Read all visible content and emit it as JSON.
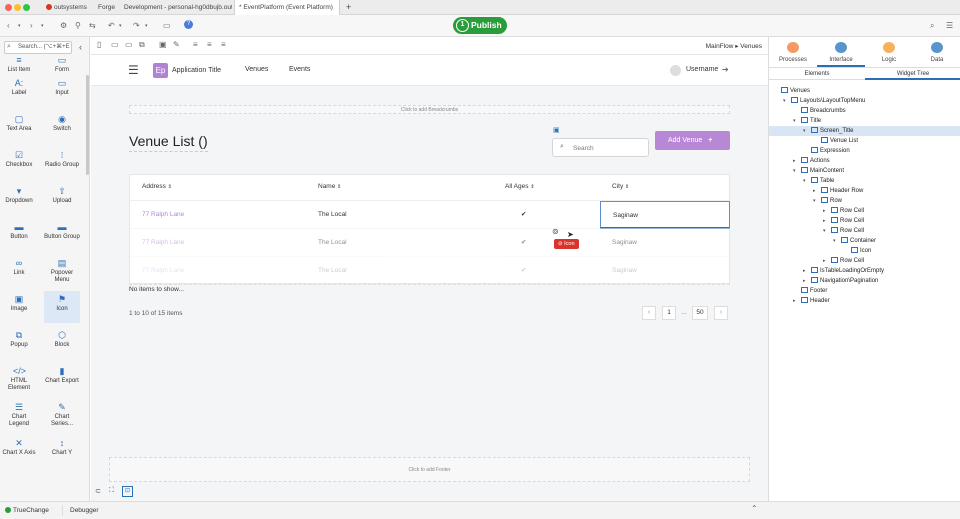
{
  "browser": {
    "tabs": [
      "outsystems",
      "Forge",
      "Development - personal-hg0dbujb.outs",
      "* EventPlatform (Event Platform)"
    ],
    "new_tab": "+"
  },
  "toolbar": {
    "publish_step": "1",
    "publish_label": "Publish",
    "help": "?"
  },
  "palette": {
    "search_placeholder": "Search... (⌥+⌘+E",
    "items": [
      {
        "label": "List Item",
        "icon": "list-item-icon",
        "glyph": "≡"
      },
      {
        "label": "Form",
        "icon": "form-icon",
        "glyph": "▭"
      },
      {
        "label": "Label",
        "icon": "label-icon",
        "glyph": "A:"
      },
      {
        "label": "Input",
        "icon": "input-icon",
        "glyph": "▭"
      },
      {
        "label": "Text Area",
        "icon": "text-area-icon",
        "glyph": "▢"
      },
      {
        "label": "Switch",
        "icon": "switch-icon",
        "glyph": "◉"
      },
      {
        "label": "Checkbox",
        "icon": "checkbox-icon",
        "glyph": "☑"
      },
      {
        "label": "Radio Group",
        "icon": "radio-group-icon",
        "glyph": "⁝"
      },
      {
        "label": "Dropdown",
        "icon": "dropdown-icon",
        "glyph": "▾"
      },
      {
        "label": "Upload",
        "icon": "upload-icon",
        "glyph": "⇧"
      },
      {
        "label": "Button",
        "icon": "button-icon",
        "glyph": "▬"
      },
      {
        "label": "Button Group",
        "icon": "button-group-icon",
        "glyph": "▬"
      },
      {
        "label": "Link",
        "icon": "link-icon",
        "glyph": "∞"
      },
      {
        "label": "Popover Menu",
        "icon": "popover-menu-icon",
        "glyph": "▤"
      },
      {
        "label": "Image",
        "icon": "image-icon",
        "glyph": "▣"
      },
      {
        "label": "Icon",
        "icon": "flag-icon",
        "glyph": "⚑"
      },
      {
        "label": "Popup",
        "icon": "popup-icon",
        "glyph": "⧉"
      },
      {
        "label": "Block",
        "icon": "block-icon",
        "glyph": "⬡"
      },
      {
        "label": "HTML Element",
        "icon": "html-element-icon",
        "glyph": "</>"
      },
      {
        "label": "Chart Export",
        "icon": "chart-export-icon",
        "glyph": "▮"
      },
      {
        "label": "Chart Legend",
        "icon": "chart-legend-icon",
        "glyph": "☰"
      },
      {
        "label": "Chart Series...",
        "icon": "chart-series-icon",
        "glyph": "✎"
      },
      {
        "label": "Chart X Axis",
        "icon": "chart-x-axis-icon",
        "glyph": "✕"
      },
      {
        "label": "Chart Y",
        "icon": "chart-y-axis-icon",
        "glyph": "↕"
      }
    ]
  },
  "canvas": {
    "breadcrumb": "MainFlow ▸ Venues",
    "app_logo": "Ep",
    "app_title": "Application Title",
    "nav": [
      "Venues",
      "Events"
    ],
    "username": "Username",
    "breadcrumbs_placeholder": "Click to add Breadcrumbs",
    "page_title": "Venue List ()",
    "search_placeholder": "Search",
    "add_button": "Add Venue",
    "columns": [
      "Address",
      "Name",
      "All Ages",
      "City"
    ],
    "rows": [
      {
        "address": "77 Ralph Lane",
        "name": "The Local",
        "all_ages": "✔",
        "city": "Saginaw"
      },
      {
        "address": "77 Ralph Lane",
        "name": "The Local",
        "all_ages": "✔",
        "city": "Saginaw"
      },
      {
        "address": "77 Ralph Lane",
        "name": "The Local",
        "all_ages": "✔",
        "city": "Saginaw"
      }
    ],
    "drag_tag": "Icon",
    "empty_msg": "No items to show...",
    "pagination_summary": "1 to 10 of 15 items",
    "pages": [
      "‹",
      "1",
      "...",
      "50",
      "›"
    ],
    "footer_placeholder": "Click to add Footer"
  },
  "right_panel": {
    "tabs": [
      {
        "label": "Processes",
        "color": "#f08a4b"
      },
      {
        "label": "Interface",
        "color": "#3b82c4"
      },
      {
        "label": "Logic",
        "color": "#f4a340"
      },
      {
        "label": "Data",
        "color": "#3b82c4"
      }
    ],
    "subtabs": [
      "Elements",
      "Widget Tree"
    ],
    "tree": [
      {
        "label": "Venues",
        "depth": 0,
        "arrow": ""
      },
      {
        "label": "Layouts\\LayoutTopMenu",
        "depth": 1,
        "arrow": "▾"
      },
      {
        "label": "Breadcrumbs",
        "depth": 2,
        "arrow": ""
      },
      {
        "label": "Title",
        "depth": 2,
        "arrow": "▾"
      },
      {
        "label": "Screen_Title",
        "depth": 3,
        "arrow": "▾"
      },
      {
        "label": "Venue List",
        "depth": 4,
        "arrow": ""
      },
      {
        "label": "Expression",
        "depth": 3,
        "arrow": ""
      },
      {
        "label": "Actions",
        "depth": 2,
        "arrow": "▸"
      },
      {
        "label": "MainContent",
        "depth": 2,
        "arrow": "▾"
      },
      {
        "label": "Table",
        "depth": 3,
        "arrow": "▾"
      },
      {
        "label": "Header Row",
        "depth": 4,
        "arrow": "▸"
      },
      {
        "label": "Row",
        "depth": 4,
        "arrow": "▾"
      },
      {
        "label": "Row Cell",
        "depth": 5,
        "arrow": "▸"
      },
      {
        "label": "Row Cell",
        "depth": 5,
        "arrow": "▸"
      },
      {
        "label": "Row Cell",
        "depth": 5,
        "arrow": "▾"
      },
      {
        "label": "Container",
        "depth": 6,
        "arrow": "▾"
      },
      {
        "label": "Icon",
        "depth": 7,
        "arrow": ""
      },
      {
        "label": "Row Cell",
        "depth": 5,
        "arrow": "▸"
      },
      {
        "label": "IsTableLoadingOrEmpty",
        "depth": 3,
        "arrow": "▸"
      },
      {
        "label": "Navigation\\Pagination",
        "depth": 3,
        "arrow": "▸"
      },
      {
        "label": "Footer",
        "depth": 2,
        "arrow": ""
      },
      {
        "label": "Header",
        "depth": 2,
        "arrow": "▸"
      }
    ]
  },
  "bottom": {
    "truechange": "TrueChange",
    "debugger": "Debugger"
  }
}
